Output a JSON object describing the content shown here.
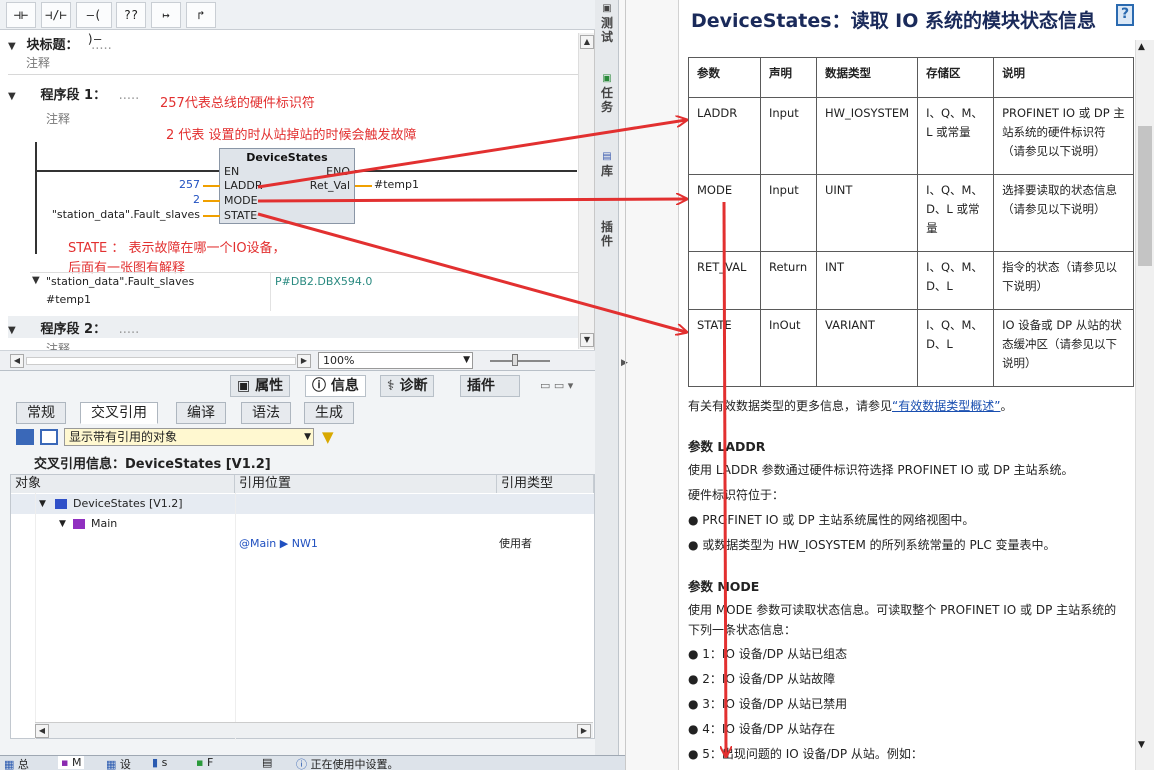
{
  "toolbar": {
    "buttons": [
      "⊣⊢",
      "⊣/⊢",
      "–( )–",
      "??",
      "↦",
      "↱"
    ]
  },
  "block_title": {
    "label": "块标题：",
    "placeholder": ".....",
    "comment": "注释"
  },
  "network1": {
    "label": "程序段 1：",
    "dots": ".....",
    "comment": "注释",
    "annotation_line1": "257代表总线的硬件标识符",
    "annotation_line2": "2 代表 设置的时从站掉站的时候会触发故障",
    "annotation_state_1": "STATE ： 表示故障在哪一个IO设备，",
    "annotation_state_2": "后面有一张图有解释",
    "fb_name": "DeviceStates",
    "pins": {
      "en": "EN",
      "eno": "ENO",
      "laddr": "LADDR",
      "mode": "MODE",
      "state": "STATE",
      "ret_val": "Ret_Val"
    },
    "values": {
      "laddr": "257",
      "mode": "2",
      "state": "\"station_data\".Fault_slaves",
      "ret_val": "#temp1"
    },
    "var_table": [
      {
        "name": "\"station_data\".Fault_slaves",
        "address": "P#DB2.DBX594.0"
      },
      {
        "name": "#temp1",
        "address": ""
      }
    ]
  },
  "network2": {
    "label": "程序段 2：",
    "dots": ".....",
    "comment": "注释"
  },
  "zoom": "100%",
  "inspector": {
    "top_tabs": [
      "属性",
      "信息",
      "诊断",
      "插件"
    ],
    "sub_tabs": [
      "常规",
      "交叉引用",
      "编译",
      "语法",
      "生成"
    ],
    "filter": "显示带有引用的对象",
    "xref_title": "交叉引用信息：DeviceStates [V1.2]",
    "columns": [
      "对象",
      "引用位置",
      "引用类型"
    ],
    "rows": [
      {
        "object": "DeviceStates [V1.2]",
        "location": "",
        "type": ""
      },
      {
        "object": "Main",
        "location": "",
        "type": ""
      },
      {
        "object": "",
        "location": "@Main ▶ NW1",
        "type": "使用者"
      }
    ]
  },
  "side_tabs": [
    "测试",
    "任务",
    "库",
    "插件"
  ],
  "help": {
    "title": "DeviceStates：读取 IO 系统的模块状态信息",
    "table_headers": [
      "参数",
      "声明",
      "数据类型",
      "存储区",
      "说明"
    ],
    "table_rows": [
      [
        "LADDR",
        "Input",
        "HW_IOSYSTEM",
        "I、Q、M、L 或常量",
        "PROFINET IO 或 DP 主站系统的硬件标识符（请参见以下说明）"
      ],
      [
        "MODE",
        "Input",
        "UINT",
        "I、Q、M、D、L 或常量",
        "选择要读取的状态信息（请参见以下说明）"
      ],
      [
        "RET_VAL",
        "Return",
        "INT",
        "I、Q、M、D、L",
        "指令的状态（请参见以下说明）"
      ],
      [
        "STATE",
        "InOut",
        "VARIANT",
        "I、Q、M、D、L",
        "IO 设备或 DP 从站的状态缓冲区（请参见以下说明）"
      ]
    ],
    "more_info_pre": "有关有效数据类型的更多信息，请参见",
    "more_info_link": "“有效数据类型概述”",
    "more_info_post": "。",
    "laddr_heading": "参数 LADDR",
    "laddr_text": "使用 LADDR 参数通过硬件标识符选择 PROFINET IO 或 DP 主站系统。",
    "laddr_loc": "硬件标识符位于：",
    "laddr_bullets": [
      "PROFINET IO 或 DP 主站系统属性的网络视图中。",
      "或数据类型为 HW_IOSYSTEM 的所列系统常量的 PLC 变量表中。"
    ],
    "mode_heading": "参数 MODE",
    "mode_text": "使用 MODE 参数可读取状态信息。可读取整个 PROFINET IO 或 DP 主站系统的下列一条状态信息：",
    "mode_bullets": [
      "1：IO 设备/DP 从站已组态",
      "2：IO 设备/DP 从站故障",
      "3：IO 设备/DP 从站已禁用",
      "4：IO 设备/DP 从站存在",
      "5：出现问题的 IO 设备/DP 从站。例如："
    ]
  },
  "taskbar": {
    "items": [
      "总",
      "M",
      "设",
      "s",
      "F"
    ],
    "status": "正在使用中设置。"
  },
  "colors": {
    "annotation": "#e23030",
    "arrow": "#e23030",
    "wire": "#f0a000",
    "link": "#1a4fb0"
  }
}
